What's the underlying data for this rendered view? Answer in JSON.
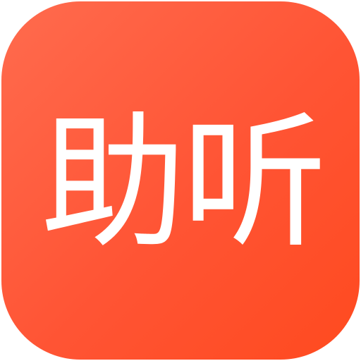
{
  "app_icon": {
    "label": "助听",
    "background_color_start": "#ff6b4e",
    "background_color_end": "#ff4a1f",
    "text_color": "#ffffff"
  }
}
